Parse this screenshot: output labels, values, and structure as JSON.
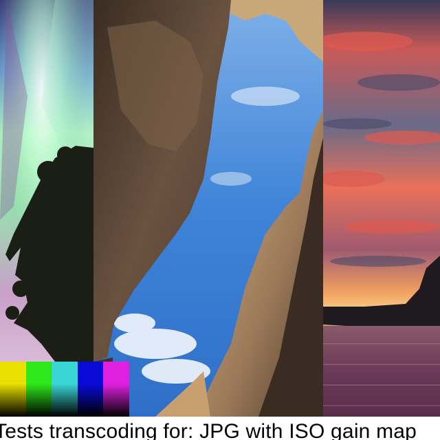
{
  "caption": {
    "text": "Tests transcoding for: JPG with ISO gain map"
  },
  "panels": [
    {
      "name": "aurora-tree-photo"
    },
    {
      "name": "canyon-sky-photo"
    },
    {
      "name": "sunset-sea-photo"
    }
  ],
  "swatches": [
    {
      "name": "yellow",
      "color": "#e8e000"
    },
    {
      "name": "green",
      "color": "#2ee81a"
    },
    {
      "name": "cyan",
      "color": "#3ad6d6"
    },
    {
      "name": "blue",
      "color": "#0a0ad8"
    },
    {
      "name": "magenta",
      "color": "#e020e0"
    }
  ]
}
